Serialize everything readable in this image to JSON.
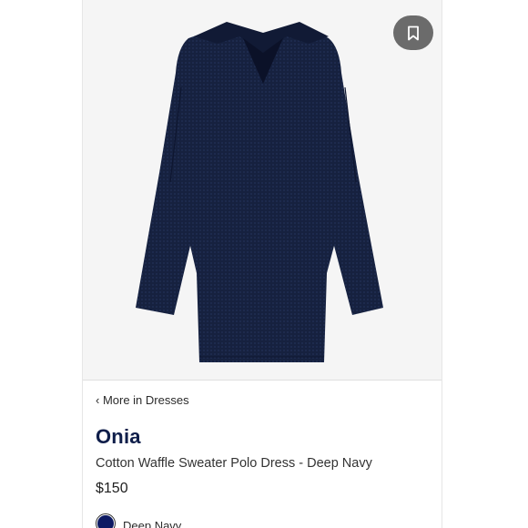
{
  "breadcrumb": {
    "label": "‹ More in Dresses"
  },
  "product": {
    "brand": "Onia",
    "title": "Cotton Waffle Sweater Polo Dress - Deep Navy",
    "price": "$150",
    "color_name": "Deep Navy",
    "color_hex": "#0d1a63"
  },
  "actions": {
    "bookmark_icon": "bookmark-icon"
  }
}
